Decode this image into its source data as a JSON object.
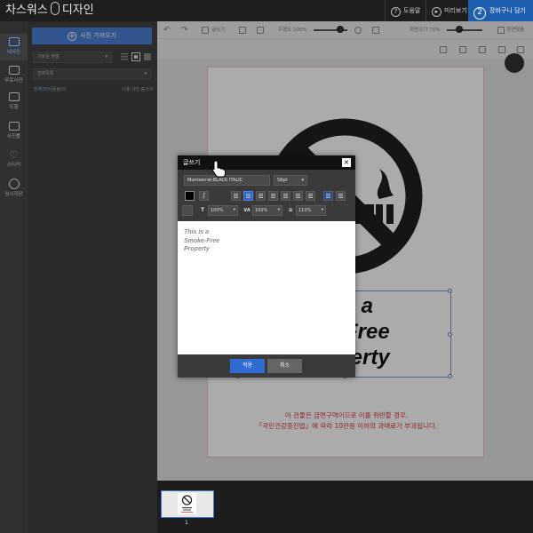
{
  "header": {
    "brand_left": "차스워스",
    "brand_right": "디자인",
    "help_label": "도움말",
    "preview_label": "미리보기",
    "cart_step": "2",
    "cart_label": "장바구니 담기"
  },
  "leftnav": {
    "items": [
      {
        "label": "내사진"
      },
      {
        "label": "무료사진"
      },
      {
        "label": "도형"
      },
      {
        "label": "사진틀"
      },
      {
        "label": "스티커"
      },
      {
        "label": "임시저장"
      }
    ]
  },
  "leftpanel": {
    "import_label": "사진 가져오기",
    "sort_label": "가로순 정렬",
    "filter_label": "전체목록",
    "all_link": "전체(0)",
    "used_link": "사용됨(0)",
    "hide_link": "사용 사진 숨기기"
  },
  "toolbar": {
    "write_label": "글쓰기",
    "zoom_label": "주행도 100%",
    "zoom_fraction": 0.8,
    "rotate_label": "화면크기 75%",
    "rotate_fraction": 0.35,
    "mode_label": "화면맞춤"
  },
  "canvas": {
    "big_text": [
      "is a",
      "-Free",
      "perty"
    ],
    "warning_lines": [
      "이 건물은 금연구역이므로 이를 위반할 경우,",
      "「국민건강증진법」에 따라 10만원 이하의 과태료가 부과됩니다."
    ],
    "thumb_label": "1"
  },
  "dialog": {
    "title": "글쓰기",
    "close_glyph": "×",
    "font_value": "Montserrat-BLACK ITALIC",
    "size_value": "56pt",
    "italic_glyph": "I",
    "height_value": "100%",
    "spacing_value": "100%",
    "line_value": "110%",
    "height_tag": "T",
    "spacing_tag": "VA",
    "text_lines": [
      "This is a",
      "Smoke-Free",
      "Property"
    ],
    "apply_label": "적용",
    "cancel_label": "취소"
  },
  "colors": {
    "accent": "#2f6bd1",
    "warning": "#dd3333",
    "header_bg": "#1e1e1e"
  },
  "icons": [
    "back-arrow-icon",
    "forward-arrow-icon",
    "text-icon",
    "layer-icon",
    "no-smoking-icon",
    "mouse-cursor-icon"
  ]
}
